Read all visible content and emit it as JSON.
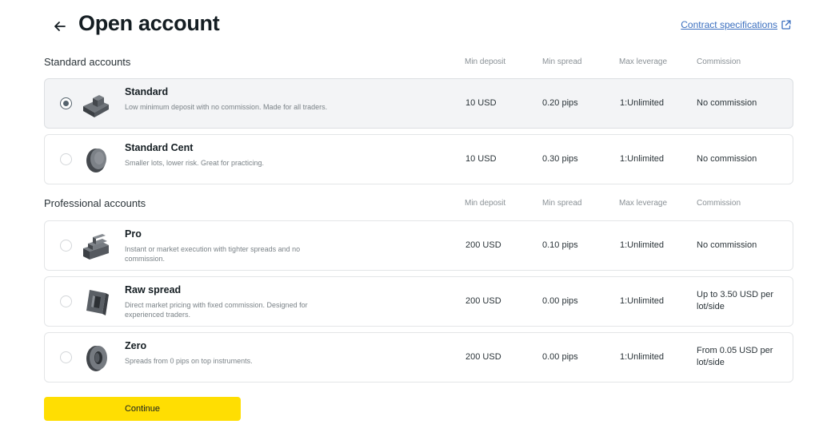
{
  "header": {
    "title": "Open account",
    "contract_link": "Contract specifications"
  },
  "columns": {
    "min_deposit": "Min deposit",
    "min_spread": "Min spread",
    "max_leverage": "Max leverage",
    "commission": "Commission"
  },
  "sections": {
    "standard": {
      "title": "Standard accounts"
    },
    "professional": {
      "title": "Professional accounts"
    }
  },
  "accounts": [
    {
      "name": "Standard",
      "description": "Low minimum deposit with no commission. Made for all traders.",
      "min_deposit": "10 USD",
      "min_spread": "0.20 pips",
      "max_leverage": "1:Unlimited",
      "commission": "No commission",
      "selected": true,
      "icon": "standard-account-icon"
    },
    {
      "name": "Standard Cent",
      "description": "Smaller lots, lower risk. Great for practicing.",
      "min_deposit": "10 USD",
      "min_spread": "0.30 pips",
      "max_leverage": "1:Unlimited",
      "commission": "No commission",
      "selected": false,
      "icon": "standard-cent-account-icon"
    },
    {
      "name": "Pro",
      "description": "Instant or market execution with tighter spreads and no commission.",
      "min_deposit": "200 USD",
      "min_spread": "0.10 pips",
      "max_leverage": "1:Unlimited",
      "commission": "No commission",
      "selected": false,
      "icon": "pro-account-icon"
    },
    {
      "name": "Raw spread",
      "description": "Direct market pricing with fixed commission. Designed for experienced traders.",
      "min_deposit": "200 USD",
      "min_spread": "0.00 pips",
      "max_leverage": "1:Unlimited",
      "commission": "Up to 3.50 USD per lot/side",
      "selected": false,
      "icon": "raw-spread-account-icon"
    },
    {
      "name": "Zero",
      "description": "Spreads from 0 pips on top instruments.",
      "min_deposit": "200 USD",
      "min_spread": "0.00 pips",
      "max_leverage": "1:Unlimited",
      "commission": "From 0.05 USD per lot/side",
      "selected": false,
      "icon": "zero-account-icon"
    }
  ],
  "footer": {
    "continue_label": "Continue"
  },
  "colors": {
    "accent": "#ffde02",
    "link": "#3b6fbf",
    "selected_bg": "#f3f4f6",
    "text": "#141d22",
    "muted": "#7a8287"
  }
}
